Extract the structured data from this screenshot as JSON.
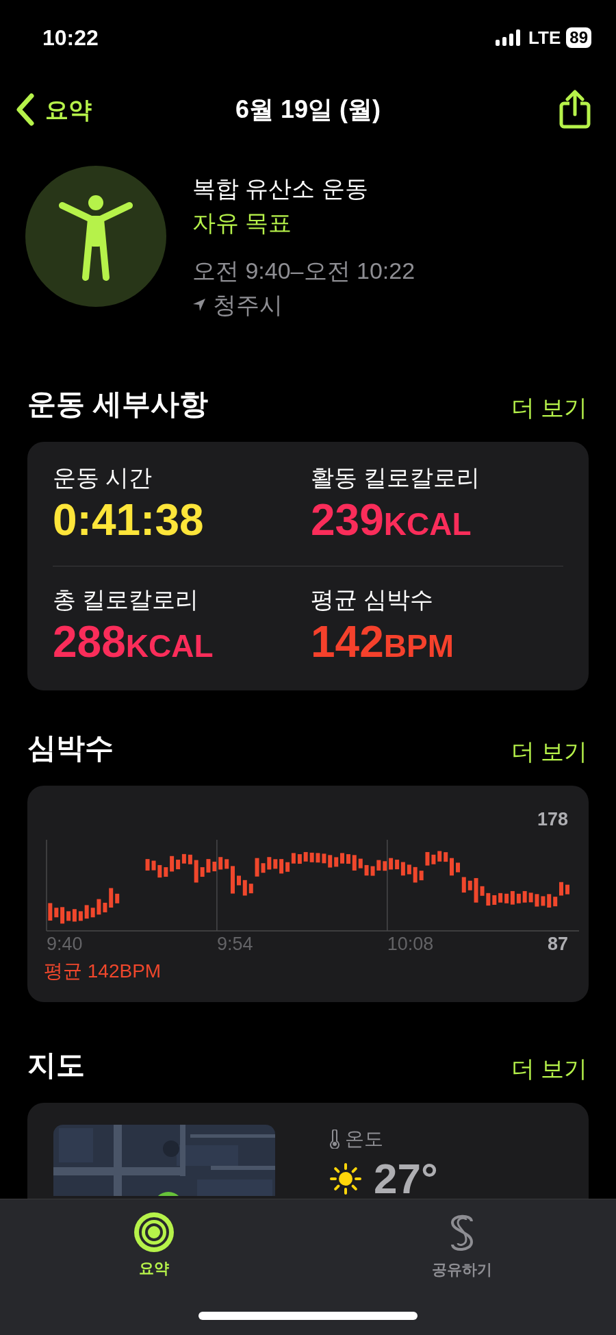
{
  "status_bar": {
    "time": "10:22",
    "network": "LTE",
    "battery": "89"
  },
  "nav": {
    "back": "요약",
    "title": "6월 19일 (월)"
  },
  "workout": {
    "name": "복합 유산소 운동",
    "goal": "자유 목표",
    "time_range": "오전 9:40–오전 10:22",
    "location": "청주시"
  },
  "details": {
    "title": "운동 세부사항",
    "more": "더 보기",
    "metrics": [
      {
        "label": "운동 시간",
        "value": "0:41:38",
        "color": "#fde53a"
      },
      {
        "label": "활동 킬로칼로리",
        "value": "239",
        "unit": "KCAL",
        "color": "#fa2d5a"
      },
      {
        "label": "총 킬로칼로리",
        "value": "288",
        "unit": "KCAL",
        "color": "#fa2d5a"
      },
      {
        "label": "평균 심박수",
        "value": "142",
        "unit": "BPM",
        "color": "#f5412c"
      }
    ]
  },
  "heart_rate": {
    "title": "심박수",
    "more": "더 보기",
    "y_max": "178",
    "y_min": "87",
    "x_labels": [
      "9:40",
      "9:54",
      "10:08"
    ],
    "average": "평균 142BPM"
  },
  "map": {
    "title": "지도",
    "more": "더 보기",
    "temperature_label": "온도",
    "temperature": "27°"
  },
  "tab_bar": [
    {
      "label": "요약",
      "selected": true,
      "kind": "rings"
    },
    {
      "label": "공유하기",
      "selected": false,
      "kind": "share"
    }
  ]
}
